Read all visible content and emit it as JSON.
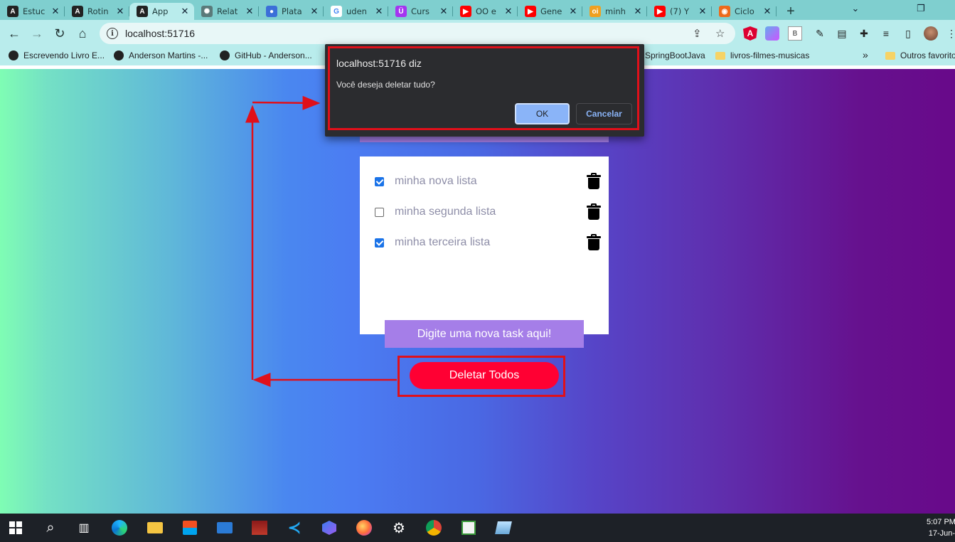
{
  "browser": {
    "tabs": [
      {
        "title": "Estuc",
        "icon": "angular-icon",
        "color": "#222222",
        "glyph": "A"
      },
      {
        "title": "Rotin",
        "icon": "angular-icon",
        "color": "#222222",
        "glyph": "A"
      },
      {
        "title": "App",
        "icon": "angular-icon",
        "color": "#222222",
        "glyph": "A",
        "active": true
      },
      {
        "title": "Relat",
        "icon": "openai-icon",
        "color": "#5a7a7a",
        "glyph": "✺"
      },
      {
        "title": "Plata",
        "icon": "globe-icon",
        "color": "#3b6fd8",
        "glyph": "●"
      },
      {
        "title": "uden",
        "icon": "google-icon",
        "color": "#ffffff",
        "glyph": "G"
      },
      {
        "title": "Curs",
        "icon": "udemy-icon",
        "color": "#a435f0",
        "glyph": "Ü"
      },
      {
        "title": "OO e",
        "icon": "youtube-icon",
        "color": "#ff0000",
        "glyph": "▶"
      },
      {
        "title": "Gene",
        "icon": "youtube-icon",
        "color": "#ff0000",
        "glyph": "▶"
      },
      {
        "title": "minh",
        "icon": "ruby-icon",
        "color": "#f0a020",
        "glyph": "oi"
      },
      {
        "title": "(7) Y",
        "icon": "youtube-icon",
        "color": "#ff0000",
        "glyph": "▶"
      },
      {
        "title": "Ciclo",
        "icon": "cycle-icon",
        "color": "#ee6a1a",
        "glyph": "◉"
      }
    ],
    "new_tab_label": "+",
    "url": "localhost:51716",
    "bookmarks": [
      {
        "label": "Escrevendo Livro E..."
      },
      {
        "label": "Anderson Martins -..."
      },
      {
        "label": "GitHub - Anderson..."
      },
      {
        "label": "SpringBootJava"
      },
      {
        "label": "livros-filmes-musicas"
      },
      {
        "label": "Outros favoritos"
      }
    ],
    "bookmarks_overflow": "»"
  },
  "dialog": {
    "origin": "localhost:51716 diz",
    "message": "Você deseja deletar tudo?",
    "ok_label": "OK",
    "cancel_label": "Cancelar"
  },
  "app": {
    "tasks": [
      {
        "label": "minha nova lista",
        "checked": true
      },
      {
        "label": "minha segunda lista",
        "checked": false
      },
      {
        "label": "minha terceira lista",
        "checked": true
      }
    ],
    "new_task_label": "Digite uma nova task aqui!",
    "delete_all_label": "Deletar Todos"
  },
  "taskbar": {
    "time": "5:07 PM",
    "date": "17-Jun-"
  },
  "colors": {
    "accent_purple": "#a57ee8",
    "delete_red": "#ff0033",
    "annotation_red": "#e0101a",
    "dialog_ok_blue": "#8ab4f8"
  }
}
